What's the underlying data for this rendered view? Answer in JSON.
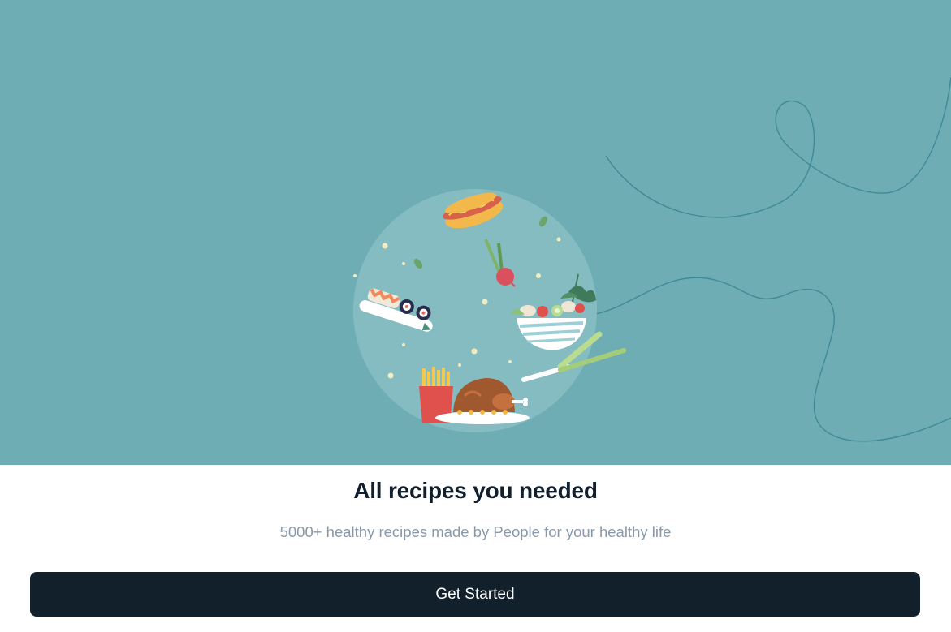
{
  "onboarding": {
    "title": "All recipes you needed",
    "subtitle": "5000+ healthy recipes made by People for your healthy life",
    "cta_label": "Get Started"
  },
  "illustration": {
    "icons": [
      "hotdog-icon",
      "radish-icon",
      "sushi-icon",
      "salad-bowl-icon",
      "leek-icon",
      "fries-icon",
      "roast-chicken-icon"
    ]
  },
  "colors": {
    "hero_background": "#6fadb5",
    "circle": "#85bcc2",
    "title_text": "#111f2c",
    "subtitle_text": "#8a99a9",
    "button_background": "#12202c",
    "button_text": "#ffffff"
  }
}
